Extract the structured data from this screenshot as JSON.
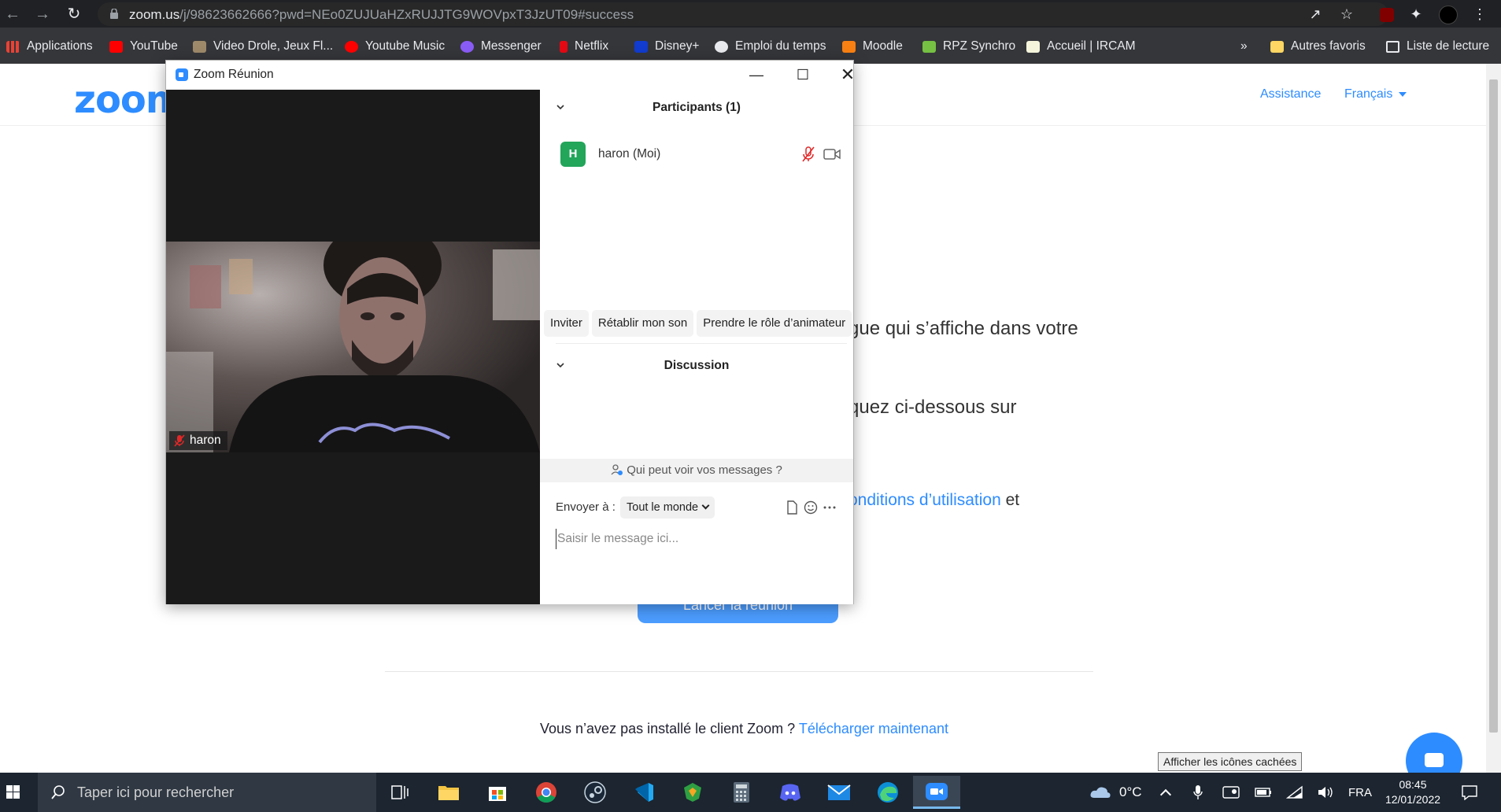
{
  "browser": {
    "url_host": "zoom.us",
    "url_path": "/j/98623662666?pwd=NEo0ZUJUaHZxRUJJTG9WOVpxT3JzUT09#success",
    "bookmarks": [
      {
        "label": "Applications",
        "color": "#e94235"
      },
      {
        "label": "YouTube",
        "color": "#ff0000"
      },
      {
        "label": "Video Drole, Jeux Fl...",
        "color": "#9e8a6a"
      },
      {
        "label": "Youtube Music",
        "color": "#ff0000"
      },
      {
        "label": "Messenger",
        "color": "#8a5cf6"
      },
      {
        "label": "Netflix",
        "color": "#e50914"
      },
      {
        "label": "Disney+",
        "color": "#113ccf"
      },
      {
        "label": "Emploi du temps",
        "color": "#e8eaed"
      },
      {
        "label": "Moodle",
        "color": "#f98012"
      },
      {
        "label": "RPZ Synchro",
        "color": "#76c043"
      },
      {
        "label": "Accueil | IRCAM",
        "color": "#f5f5dc"
      }
    ],
    "overflow": "»",
    "other_bookmarks": "Autres favoris",
    "reading_list": "Liste de lecture"
  },
  "page": {
    "logo": "zoom",
    "support_link": "Assistance",
    "language": "Français",
    "line1": "gue qui s’affiche dans votre",
    "line2": "quez ci-dessous sur",
    "terms_link": "onditions d’utilisation",
    "terms_after": " et",
    "launch_button": "Lancer la réunion",
    "footer_text": "Vous n’avez pas installé le client Zoom ? ",
    "footer_link": "Télécharger maintenant"
  },
  "zoom_window": {
    "title": "Zoom Réunion",
    "video_name": "haron",
    "participants_title": "Participants (1)",
    "participant": {
      "initial": "H",
      "name": "haron (Moi)"
    },
    "actions": [
      "Inviter",
      "Rétablir mon son",
      "Prendre le rôle d’animateur"
    ],
    "chat_title": "Discussion",
    "who_can_see": "Qui peut voir vos messages ?",
    "send_to_label": "Envoyer à :",
    "send_to_value": "Tout le monde",
    "message_placeholder": "Saisir le message ici..."
  },
  "tooltip": "Afficher les icônes cachées",
  "taskbar": {
    "search_placeholder": "Taper ici pour rechercher",
    "temperature": "0°C",
    "language": "FRA",
    "time": "08:45",
    "date": "12/01/2022"
  }
}
